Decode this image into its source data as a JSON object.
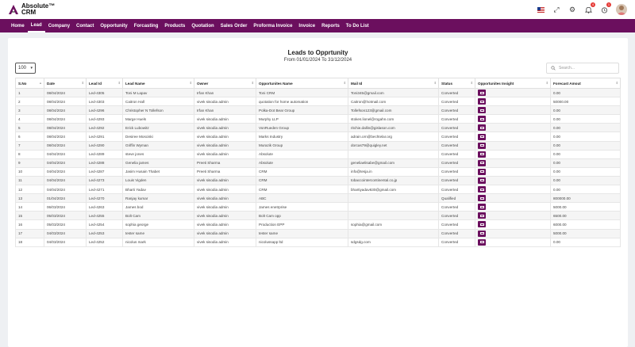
{
  "header": {
    "logo_line1": "Absolute™",
    "logo_line2": "CRM",
    "notification_count": "4",
    "alert_count": "1"
  },
  "nav": [
    "Home",
    "Lead",
    "Company",
    "Contact",
    "Opportunity",
    "Forcasting",
    "Products",
    "Quotation",
    "Sales Order",
    "Proforma Invoice",
    "Invoice",
    "Reports",
    "To Do List"
  ],
  "report": {
    "title": "Leads to Opprtunity",
    "subtitle": "From 01/01/2024 To 31/12/2024",
    "per_page": "100",
    "search_placeholder": "Search..."
  },
  "table": {
    "columns": [
      "S.No",
      "Date",
      "Lead Id",
      "Lead Name",
      "Owner",
      "Opportunites Name",
      "Mail Id",
      "Status",
      "Opportunites Insight",
      "Forecast Amout"
    ],
    "rows": [
      [
        "1",
        "08/04/2024",
        "Led-4305",
        "Toni M Lapav",
        "Irfan Khan",
        "Toni CRM",
        "Toni345@gmail.com",
        "Converted",
        "0.00"
      ],
      [
        "2",
        "08/04/2024",
        "Led-4303",
        "Caitron Hall",
        "vivek sisodia admin",
        "quotation for home automation",
        "Caitron@hotmail.com",
        "Converted",
        "50000.00"
      ],
      [
        "3",
        "08/04/2024",
        "Led-4296",
        "Christopher N Tollefson",
        "Irfan Khan",
        "Polka-Dot Bear Group",
        "Tollefson123@gmail.com",
        "Converted",
        "0.00"
      ],
      [
        "4",
        "08/04/2024",
        "Led-4293",
        "Marge Huels",
        "vivek sisodia admin",
        "Murphy LLP",
        "stokes.lionel@rogahn.com",
        "Converted",
        "0.00"
      ],
      [
        "5",
        "08/04/2024",
        "Led-4292",
        "Erick Lubowitz",
        "vivek sisodia admin",
        "VonRueden Group",
        "ritchie.dallin@gislason.com",
        "Converted",
        "0.00"
      ],
      [
        "6",
        "08/04/2024",
        "Led-4291",
        "Desiree Mosciski",
        "vivek sisodia admin",
        "Marks Industry",
        "adrain.orn@bechtelar.org",
        "Converted",
        "0.00"
      ],
      [
        "7",
        "08/04/2024",
        "Led-4290",
        "Griffin Wyman",
        "vivek sisodia admin",
        "Murazik Group",
        "dorcas79@quigley.net",
        "Converted",
        "0.00"
      ],
      [
        "8",
        "04/04/2024",
        "Led-4289",
        "steve jones",
        "vivek sisodia admin",
        "Absolute",
        "",
        "Converted",
        "0.00"
      ],
      [
        "9",
        "04/04/2024",
        "Led-4288",
        "Genelia james",
        "Preeti Sharma",
        "Absolute",
        "geneliaelisabe@gmail.com",
        "Converted",
        "0.00"
      ],
      [
        "10",
        "04/04/2024",
        "Led-4287",
        "Jasim Husain Thabet",
        "Preeti Sharma",
        "CRM",
        "info@tesja.in",
        "Converted",
        "0.00"
      ],
      [
        "11",
        "04/04/2024",
        "Led-4273",
        "Louis Vigden",
        "vivek sisodia admin",
        "CRM",
        "tobaccointercontinental.co.jp",
        "Converted",
        "0.00"
      ],
      [
        "12",
        "04/04/2024",
        "Led-4271",
        "Bharti Yadav",
        "vivek sisodia admin",
        "CRM",
        "bhartiyadav630@gmail.com",
        "Converted",
        "0.00"
      ],
      [
        "13",
        "01/04/2024",
        "Led-4270",
        "Ranjay kumar",
        "vivek sisodia admin",
        "ABC",
        "",
        "Qualified",
        "800000.00"
      ],
      [
        "14",
        "06/03/2024",
        "Led-4263",
        "James bod",
        "vivek sisodia admin",
        "James enetrprise",
        "",
        "Converted",
        "5000.00"
      ],
      [
        "15",
        "05/03/2024",
        "Led-4255",
        "Bolt Cam",
        "vivek sisodia admin",
        "Bolt Cam opp",
        "",
        "Converted",
        "6500.00"
      ],
      [
        "16",
        "05/03/2024",
        "Led-4254",
        "sophia george",
        "vivek sisodia admin",
        "Production EPP",
        "sophia@gmail.com",
        "Converted",
        "6000.00"
      ],
      [
        "17",
        "04/03/2024",
        "Led-4253",
        "tester same",
        "vivek sisodia admin",
        "tester same",
        "",
        "Converted",
        "5000.00"
      ],
      [
        "18",
        "04/03/2024",
        "Led-4252",
        "nicolus mark",
        "vivek sisodia admin",
        "nicolussapp ltd",
        "sdgsdg.com",
        "Converted",
        "0.00"
      ]
    ]
  },
  "icons": {
    "notification": "bell-icon",
    "alert": "alarm-icon",
    "settings": "gear-icon",
    "fullscreen": "expand-icon",
    "language": "us-flag-icon"
  },
  "colors": {
    "brand": "#6b0f5e",
    "link": "#3b6fd6"
  }
}
